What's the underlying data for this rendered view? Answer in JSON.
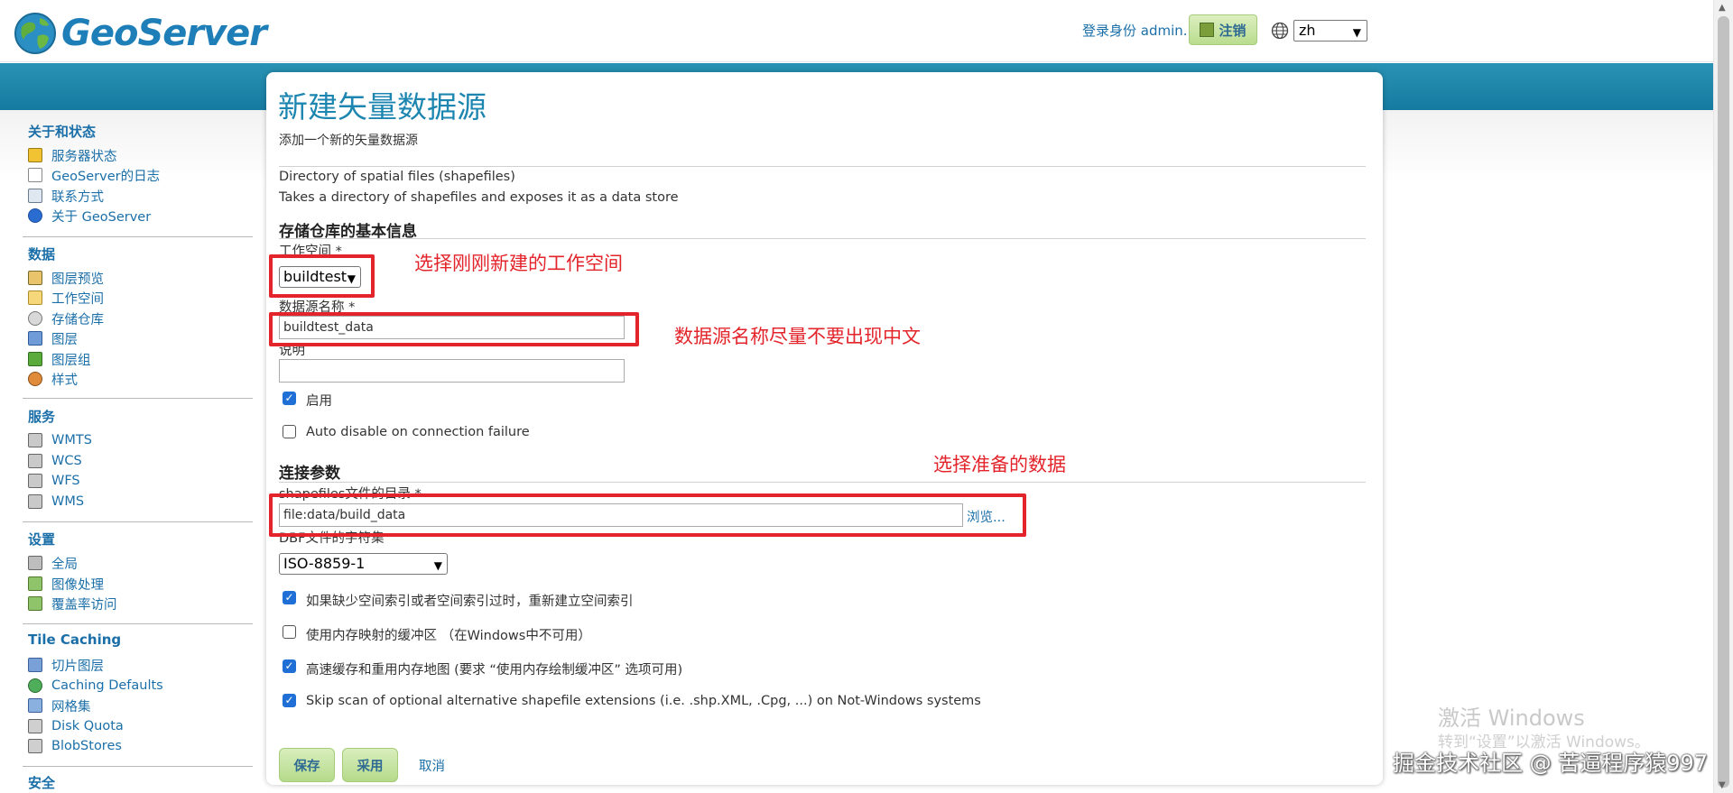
{
  "header": {
    "logo_text": "GeoServer",
    "login_text": "登录身份 admin.",
    "logout_label": "注销",
    "language": "zh"
  },
  "sidebar": {
    "sections": [
      {
        "title": "关于和状态",
        "items": [
          "服务器状态",
          "GeoServer的日志",
          "联系方式",
          "关于 GeoServer"
        ]
      },
      {
        "title": "数据",
        "items": [
          "图层预览",
          "工作空间",
          "存储仓库",
          "图层",
          "图层组",
          "样式"
        ]
      },
      {
        "title": "服务",
        "items": [
          "WMTS",
          "WCS",
          "WFS",
          "WMS"
        ]
      },
      {
        "title": "设置",
        "items": [
          "全局",
          "图像处理",
          "覆盖率访问"
        ]
      },
      {
        "title": "Tile Caching",
        "items": [
          "切片图层",
          "Caching Defaults",
          "网格集",
          "Disk Quota",
          "BlobStores"
        ]
      },
      {
        "title": "安全",
        "items": []
      }
    ]
  },
  "main": {
    "title": "新建矢量数据源",
    "subtitle": "添加一个新的矢量数据源",
    "store_type": "Directory of spatial files (shapefiles)",
    "store_desc": "Takes a directory of shapefiles and exposes it as a data store",
    "basic_info_heading": "存储仓库的基本信息",
    "workspace_label": "工作空间 *",
    "workspace_value": "buildtest",
    "datasource_name_label": "数据源名称 *",
    "datasource_name_value": "buildtest_data",
    "description_label": "说明",
    "description_value": "",
    "enabled_label": "启用",
    "enabled": true,
    "auto_disable_label": "Auto disable on connection failure",
    "auto_disable": false,
    "connection_heading": "连接参数",
    "shapefile_dir_label": "shapefiles文件的目录 *",
    "shapefile_dir_value": "file:data/build_data",
    "browse_label": "浏览...",
    "dbf_charset_label": "DBF文件的字符集",
    "dbf_charset_value": "ISO-8859-1",
    "options": [
      {
        "label": "如果缺少空间索引或者空间索引过时，重新建立空间索引",
        "checked": true
      },
      {
        "label": "使用内存映射的缓冲区 （在Windows中不可用）",
        "checked": false
      },
      {
        "label": "高速缓存和重用内存地图 (要求 “使用内存绘制缓冲区” 选项可用)",
        "checked": true
      },
      {
        "label": "Skip scan of optional alternative shapefile extensions (i.e. .shp.XML, .Cpg, ...) on Not-Windows systems",
        "checked": true
      }
    ],
    "save_label": "保存",
    "apply_label": "采用",
    "cancel_label": "取消"
  },
  "annotations": {
    "workspace_note": "选择刚刚新建的工作空间",
    "name_note": "数据源名称尽量不要出现中文",
    "data_note": "选择准备的数据"
  },
  "watermark": {
    "activate_title": "激活 Windows",
    "activate_sub": "转到“设置”以激活 Windows。",
    "site_credit": "掘金技术社区 @ 苦逼程序猿997"
  },
  "colors": {
    "brand_blue": "#1b6fa8",
    "band_teal": "#1d86a8",
    "annotation_red": "#e3242b",
    "button_green": "#b5da8a"
  }
}
